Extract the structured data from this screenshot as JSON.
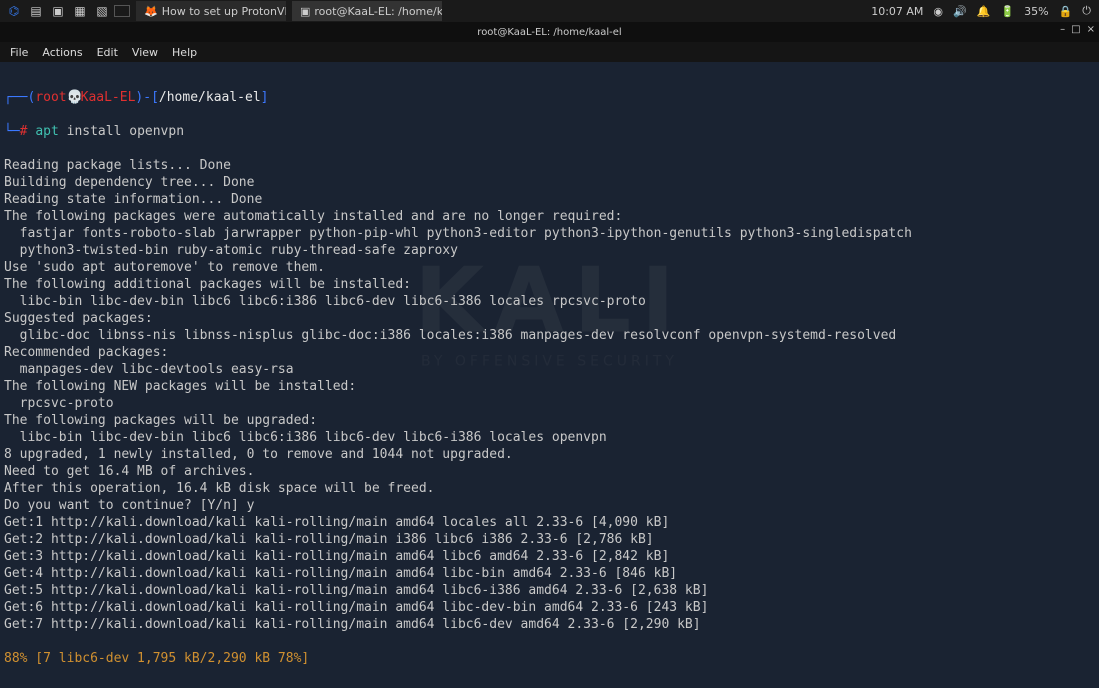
{
  "taskbar": {
    "apps": [
      {
        "icon": "🦊",
        "label": "How to set up ProtonVP..."
      },
      {
        "icon": "▣",
        "label": "root@KaaL-EL: /home/k..."
      }
    ],
    "time": "10:07 AM",
    "battery": "35%"
  },
  "titlebar": {
    "text": "root@KaaL-EL: /home/kaal-el"
  },
  "menubar": [
    "File",
    "Actions",
    "Edit",
    "View",
    "Help"
  ],
  "prompt": {
    "lparen": "(",
    "user": "root",
    "skull": "💀",
    "host": "KaaL-EL",
    "rparen": ")-[",
    "path": "/home/kaal-el",
    "close": "]",
    "hash": "#",
    "cmd_bin": "apt",
    "cmd_args": "install openvpn"
  },
  "output": [
    "Reading package lists... Done",
    "Building dependency tree... Done",
    "Reading state information... Done",
    "The following packages were automatically installed and are no longer required:",
    "  fastjar fonts-roboto-slab jarwrapper python-pip-whl python3-editor python3-ipython-genutils python3-singledispatch",
    "  python3-twisted-bin ruby-atomic ruby-thread-safe zaproxy",
    "Use 'sudo apt autoremove' to remove them.",
    "The following additional packages will be installed:",
    "  libc-bin libc-dev-bin libc6 libc6:i386 libc6-dev libc6-i386 locales rpcsvc-proto",
    "Suggested packages:",
    "  glibc-doc libnss-nis libnss-nisplus glibc-doc:i386 locales:i386 manpages-dev resolvconf openvpn-systemd-resolved",
    "Recommended packages:",
    "  manpages-dev libc-devtools easy-rsa",
    "The following NEW packages will be installed:",
    "  rpcsvc-proto",
    "The following packages will be upgraded:",
    "  libc-bin libc-dev-bin libc6 libc6:i386 libc6-dev libc6-i386 locales openvpn",
    "8 upgraded, 1 newly installed, 0 to remove and 1044 not upgraded.",
    "Need to get 16.4 MB of archives.",
    "After this operation, 16.4 kB disk space will be freed.",
    "Do you want to continue? [Y/n] y",
    "Get:1 http://kali.download/kali kali-rolling/main amd64 locales all 2.33-6 [4,090 kB]",
    "Get:2 http://kali.download/kali kali-rolling/main i386 libc6 i386 2.33-6 [2,786 kB]",
    "Get:3 http://kali.download/kali kali-rolling/main amd64 libc6 amd64 2.33-6 [2,842 kB]",
    "Get:4 http://kali.download/kali kali-rolling/main amd64 libc-bin amd64 2.33-6 [846 kB]",
    "Get:5 http://kali.download/kali kali-rolling/main amd64 libc6-i386 amd64 2.33-6 [2,638 kB]",
    "Get:6 http://kali.download/kali kali-rolling/main amd64 libc-dev-bin amd64 2.33-6 [243 kB]",
    "Get:7 http://kali.download/kali kali-rolling/main amd64 libc6-dev amd64 2.33-6 [2,290 kB]"
  ],
  "progress": "88% [7 libc6-dev 1,795 kB/2,290 kB 78%]"
}
